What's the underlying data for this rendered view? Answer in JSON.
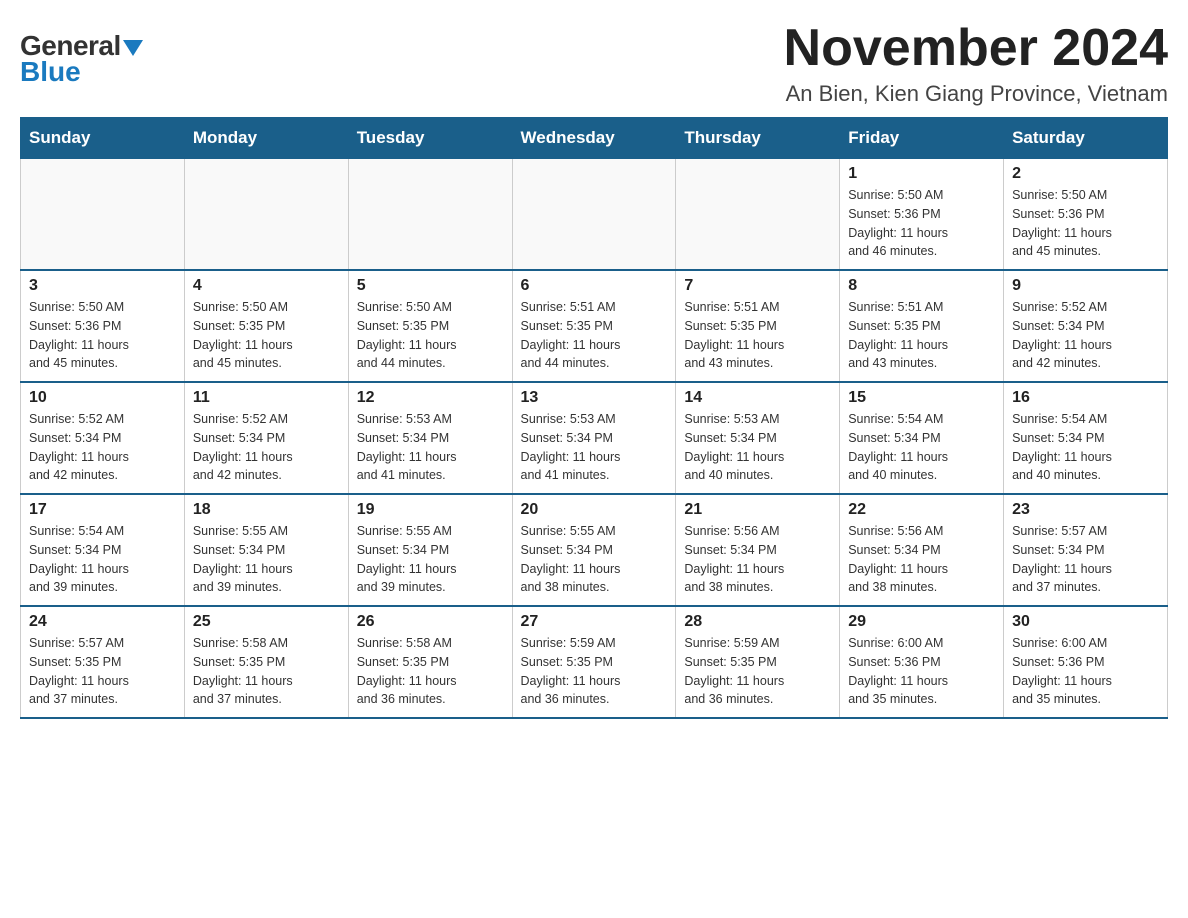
{
  "logo": {
    "general": "General",
    "blue": "Blue",
    "triangle": "▲"
  },
  "header": {
    "month_title": "November 2024",
    "location": "An Bien, Kien Giang Province, Vietnam"
  },
  "weekdays": [
    "Sunday",
    "Monday",
    "Tuesday",
    "Wednesday",
    "Thursday",
    "Friday",
    "Saturday"
  ],
  "weeks": [
    [
      {
        "day": "",
        "info": ""
      },
      {
        "day": "",
        "info": ""
      },
      {
        "day": "",
        "info": ""
      },
      {
        "day": "",
        "info": ""
      },
      {
        "day": "",
        "info": ""
      },
      {
        "day": "1",
        "info": "Sunrise: 5:50 AM\nSunset: 5:36 PM\nDaylight: 11 hours\nand 46 minutes."
      },
      {
        "day": "2",
        "info": "Sunrise: 5:50 AM\nSunset: 5:36 PM\nDaylight: 11 hours\nand 45 minutes."
      }
    ],
    [
      {
        "day": "3",
        "info": "Sunrise: 5:50 AM\nSunset: 5:36 PM\nDaylight: 11 hours\nand 45 minutes."
      },
      {
        "day": "4",
        "info": "Sunrise: 5:50 AM\nSunset: 5:35 PM\nDaylight: 11 hours\nand 45 minutes."
      },
      {
        "day": "5",
        "info": "Sunrise: 5:50 AM\nSunset: 5:35 PM\nDaylight: 11 hours\nand 44 minutes."
      },
      {
        "day": "6",
        "info": "Sunrise: 5:51 AM\nSunset: 5:35 PM\nDaylight: 11 hours\nand 44 minutes."
      },
      {
        "day": "7",
        "info": "Sunrise: 5:51 AM\nSunset: 5:35 PM\nDaylight: 11 hours\nand 43 minutes."
      },
      {
        "day": "8",
        "info": "Sunrise: 5:51 AM\nSunset: 5:35 PM\nDaylight: 11 hours\nand 43 minutes."
      },
      {
        "day": "9",
        "info": "Sunrise: 5:52 AM\nSunset: 5:34 PM\nDaylight: 11 hours\nand 42 minutes."
      }
    ],
    [
      {
        "day": "10",
        "info": "Sunrise: 5:52 AM\nSunset: 5:34 PM\nDaylight: 11 hours\nand 42 minutes."
      },
      {
        "day": "11",
        "info": "Sunrise: 5:52 AM\nSunset: 5:34 PM\nDaylight: 11 hours\nand 42 minutes."
      },
      {
        "day": "12",
        "info": "Sunrise: 5:53 AM\nSunset: 5:34 PM\nDaylight: 11 hours\nand 41 minutes."
      },
      {
        "day": "13",
        "info": "Sunrise: 5:53 AM\nSunset: 5:34 PM\nDaylight: 11 hours\nand 41 minutes."
      },
      {
        "day": "14",
        "info": "Sunrise: 5:53 AM\nSunset: 5:34 PM\nDaylight: 11 hours\nand 40 minutes."
      },
      {
        "day": "15",
        "info": "Sunrise: 5:54 AM\nSunset: 5:34 PM\nDaylight: 11 hours\nand 40 minutes."
      },
      {
        "day": "16",
        "info": "Sunrise: 5:54 AM\nSunset: 5:34 PM\nDaylight: 11 hours\nand 40 minutes."
      }
    ],
    [
      {
        "day": "17",
        "info": "Sunrise: 5:54 AM\nSunset: 5:34 PM\nDaylight: 11 hours\nand 39 minutes."
      },
      {
        "day": "18",
        "info": "Sunrise: 5:55 AM\nSunset: 5:34 PM\nDaylight: 11 hours\nand 39 minutes."
      },
      {
        "day": "19",
        "info": "Sunrise: 5:55 AM\nSunset: 5:34 PM\nDaylight: 11 hours\nand 39 minutes."
      },
      {
        "day": "20",
        "info": "Sunrise: 5:55 AM\nSunset: 5:34 PM\nDaylight: 11 hours\nand 38 minutes."
      },
      {
        "day": "21",
        "info": "Sunrise: 5:56 AM\nSunset: 5:34 PM\nDaylight: 11 hours\nand 38 minutes."
      },
      {
        "day": "22",
        "info": "Sunrise: 5:56 AM\nSunset: 5:34 PM\nDaylight: 11 hours\nand 38 minutes."
      },
      {
        "day": "23",
        "info": "Sunrise: 5:57 AM\nSunset: 5:34 PM\nDaylight: 11 hours\nand 37 minutes."
      }
    ],
    [
      {
        "day": "24",
        "info": "Sunrise: 5:57 AM\nSunset: 5:35 PM\nDaylight: 11 hours\nand 37 minutes."
      },
      {
        "day": "25",
        "info": "Sunrise: 5:58 AM\nSunset: 5:35 PM\nDaylight: 11 hours\nand 37 minutes."
      },
      {
        "day": "26",
        "info": "Sunrise: 5:58 AM\nSunset: 5:35 PM\nDaylight: 11 hours\nand 36 minutes."
      },
      {
        "day": "27",
        "info": "Sunrise: 5:59 AM\nSunset: 5:35 PM\nDaylight: 11 hours\nand 36 minutes."
      },
      {
        "day": "28",
        "info": "Sunrise: 5:59 AM\nSunset: 5:35 PM\nDaylight: 11 hours\nand 36 minutes."
      },
      {
        "day": "29",
        "info": "Sunrise: 6:00 AM\nSunset: 5:36 PM\nDaylight: 11 hours\nand 35 minutes."
      },
      {
        "day": "30",
        "info": "Sunrise: 6:00 AM\nSunset: 5:36 PM\nDaylight: 11 hours\nand 35 minutes."
      }
    ]
  ]
}
